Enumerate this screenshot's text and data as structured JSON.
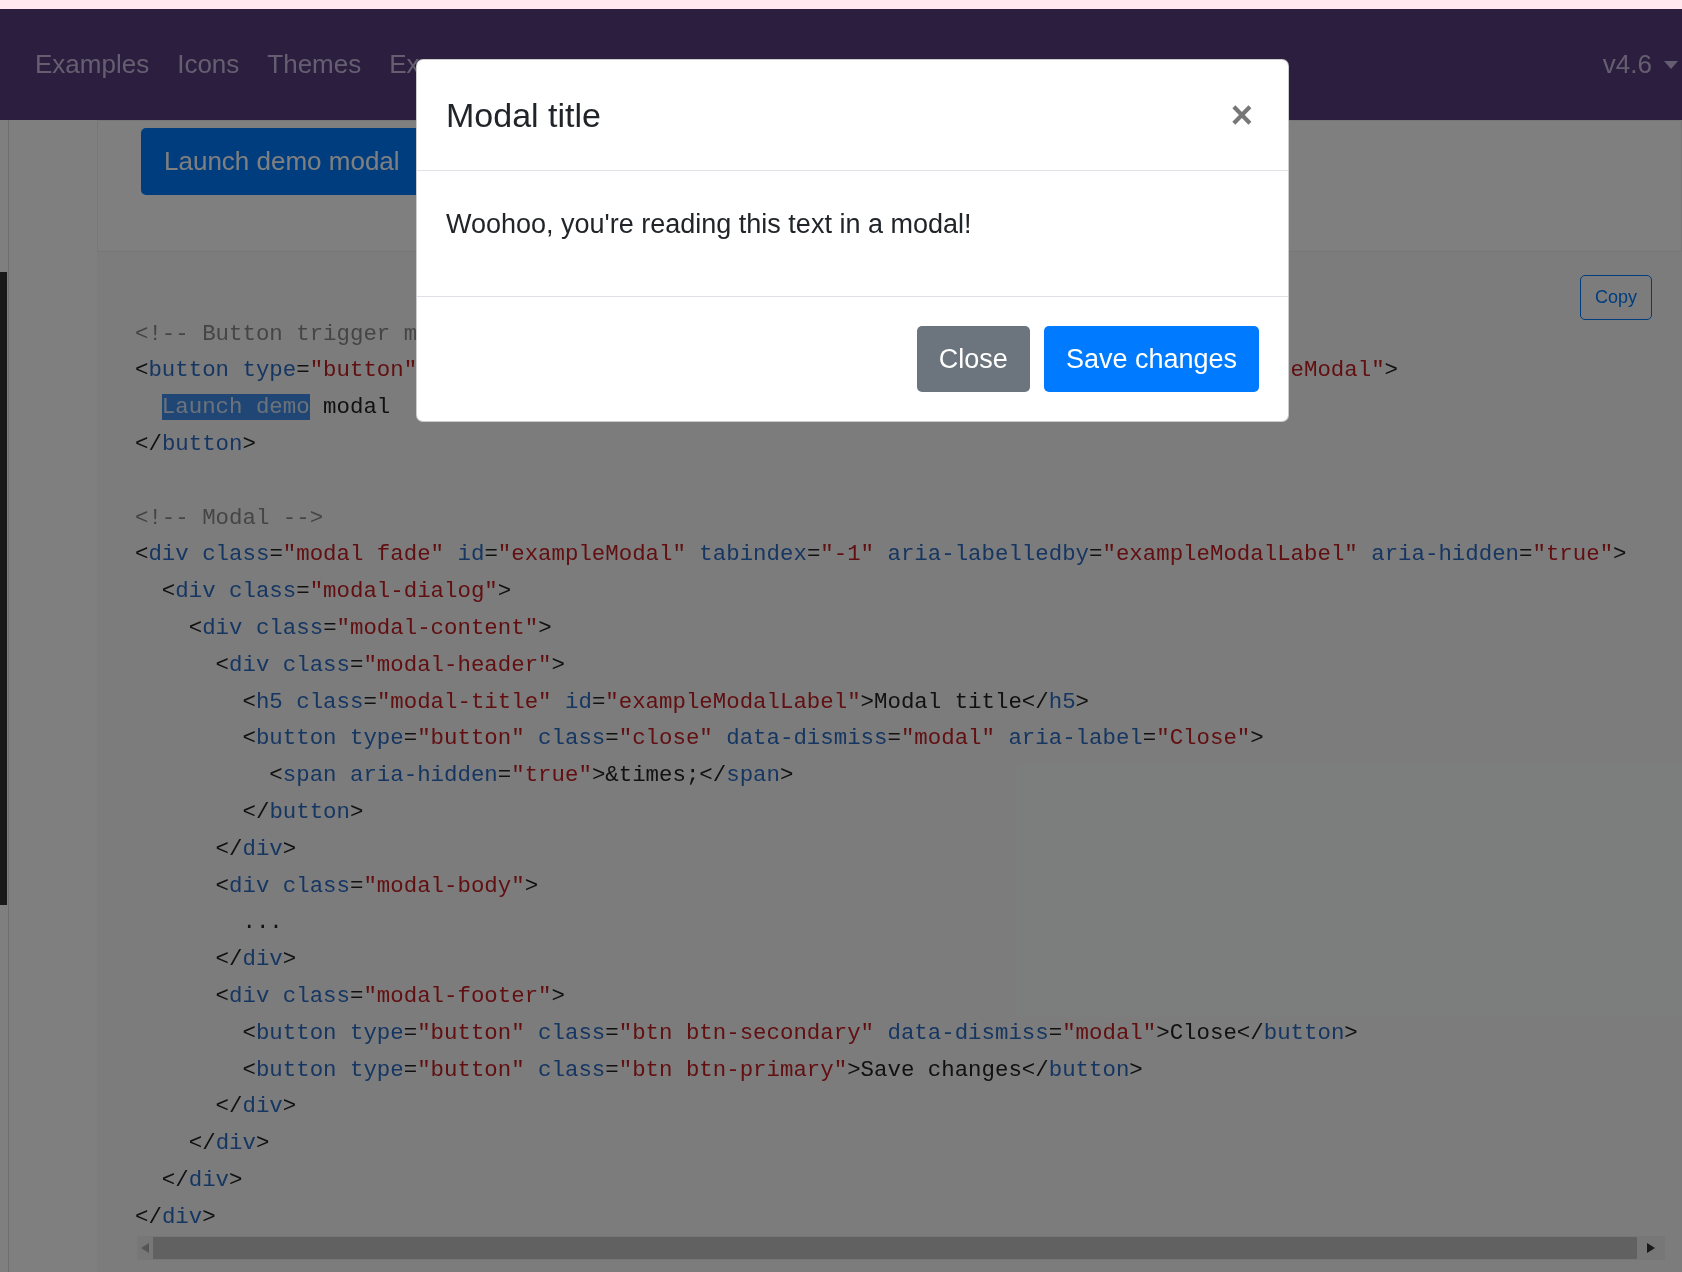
{
  "nav": {
    "items": [
      {
        "label": "Examples"
      },
      {
        "label": "Icons"
      },
      {
        "label": "Themes"
      },
      {
        "label": "Ex"
      }
    ],
    "version": "v4.6"
  },
  "example": {
    "button": "Launch demo modal"
  },
  "code": {
    "copy_button": "Copy",
    "blocks": [
      [
        {
          "left": [
            {
              "kind": "comment",
              "text": "<!-- Button trigger m"
            }
          ]
        },
        {
          "left": [
            {
              "kind": "plain",
              "text": "<"
            },
            {
              "kind": "tag",
              "text": "button"
            },
            {
              "kind": "attr",
              "text": " type"
            },
            {
              "kind": "plain",
              "text": "="
            },
            {
              "kind": "value",
              "text": "\"button\""
            }
          ],
          "right": [
            {
              "kind": "value",
              "text": "eModal\""
            },
            {
              "kind": "plain",
              "text": ">"
            }
          ]
        },
        {
          "kind": "nested",
          "left": [
            {
              "kind": "selected",
              "text": "Launch demo"
            },
            {
              "kind": "plain",
              "text": " modal"
            }
          ]
        },
        {
          "left": [
            {
              "kind": "plain",
              "text": "</"
            },
            {
              "kind": "tag",
              "text": "button"
            },
            {
              "kind": "plain",
              "text": ">"
            }
          ]
        }
      ],
      [
        {
          "left": [
            {
              "kind": "comment",
              "text": "<!-- Modal -->"
            }
          ]
        },
        {
          "left": [
            {
              "kind": "plain",
              "text": "<"
            },
            {
              "kind": "tag",
              "text": "div"
            },
            {
              "kind": "attr",
              "text": " class"
            },
            {
              "kind": "plain",
              "text": "="
            },
            {
              "kind": "value",
              "text": "\"modal fade\""
            },
            {
              "kind": "attr",
              "text": " id"
            },
            {
              "kind": "plain",
              "text": "="
            },
            {
              "kind": "value",
              "text": "\"exampleModal\""
            },
            {
              "kind": "attr",
              "text": " tabindex"
            },
            {
              "kind": "plain",
              "text": "="
            },
            {
              "kind": "value",
              "text": "\"-1\""
            },
            {
              "kind": "attr",
              "text": " aria-labelledby"
            },
            {
              "kind": "plain",
              "text": "="
            },
            {
              "kind": "value",
              "text": "\"exampleModalLabel\""
            },
            {
              "kind": "attr",
              "text": " aria-hidden"
            },
            {
              "kind": "plain",
              "text": "="
            },
            {
              "kind": "value",
              "text": "\"true\""
            },
            {
              "kind": "plain",
              "text": ">"
            }
          ]
        },
        {
          "left": [
            {
              "kind": "plain",
              "text": "  <"
            },
            {
              "kind": "tag",
              "text": "div"
            },
            {
              "kind": "attr",
              "text": " class"
            },
            {
              "kind": "plain",
              "text": "="
            },
            {
              "kind": "value",
              "text": "\"modal-dialog\""
            },
            {
              "kind": "plain",
              "text": ">"
            }
          ]
        },
        {
          "left": [
            {
              "kind": "plain",
              "text": "    <"
            },
            {
              "kind": "tag",
              "text": "div"
            },
            {
              "kind": "attr",
              "text": " class"
            },
            {
              "kind": "plain",
              "text": "="
            },
            {
              "kind": "value",
              "text": "\"modal-content\""
            },
            {
              "kind": "plain",
              "text": ">"
            }
          ]
        },
        {
          "left": [
            {
              "kind": "plain",
              "text": "      <"
            },
            {
              "kind": "tag",
              "text": "div"
            },
            {
              "kind": "attr",
              "text": " class"
            },
            {
              "kind": "plain",
              "text": "="
            },
            {
              "kind": "value",
              "text": "\"modal-header\""
            },
            {
              "kind": "plain",
              "text": ">"
            }
          ]
        },
        {
          "left": [
            {
              "kind": "plain",
              "text": "        <"
            },
            {
              "kind": "tag",
              "text": "h5"
            },
            {
              "kind": "attr",
              "text": " class"
            },
            {
              "kind": "plain",
              "text": "="
            },
            {
              "kind": "value",
              "text": "\"modal-title\""
            },
            {
              "kind": "attr",
              "text": " id"
            },
            {
              "kind": "plain",
              "text": "="
            },
            {
              "kind": "value",
              "text": "\"exampleModalLabel\""
            },
            {
              "kind": "plain",
              "text": ">Modal title</"
            },
            {
              "kind": "tag",
              "text": "h5"
            },
            {
              "kind": "plain",
              "text": ">"
            }
          ]
        },
        {
          "left": [
            {
              "kind": "plain",
              "text": "        <"
            },
            {
              "kind": "tag",
              "text": "button"
            },
            {
              "kind": "attr",
              "text": " type"
            },
            {
              "kind": "plain",
              "text": "="
            },
            {
              "kind": "value",
              "text": "\"button\""
            },
            {
              "kind": "attr",
              "text": " class"
            },
            {
              "kind": "plain",
              "text": "="
            },
            {
              "kind": "value",
              "text": "\"close\""
            },
            {
              "kind": "attr",
              "text": " data-dismiss"
            },
            {
              "kind": "plain",
              "text": "="
            },
            {
              "kind": "value",
              "text": "\"modal\""
            },
            {
              "kind": "attr",
              "text": " aria-label"
            },
            {
              "kind": "plain",
              "text": "="
            },
            {
              "kind": "value",
              "text": "\"Close\""
            },
            {
              "kind": "plain",
              "text": ">"
            }
          ]
        },
        {
          "left": [
            {
              "kind": "plain",
              "text": "          <"
            },
            {
              "kind": "tag",
              "text": "span"
            },
            {
              "kind": "attr",
              "text": " aria-hidden"
            },
            {
              "kind": "plain",
              "text": "="
            },
            {
              "kind": "value",
              "text": "\"true\""
            },
            {
              "kind": "plain",
              "text": ">&times;</"
            },
            {
              "kind": "tag",
              "text": "span"
            },
            {
              "kind": "plain",
              "text": ">"
            }
          ]
        },
        {
          "left": [
            {
              "kind": "plain",
              "text": "        </"
            },
            {
              "kind": "tag",
              "text": "button"
            },
            {
              "kind": "plain",
              "text": ">"
            }
          ]
        },
        {
          "left": [
            {
              "kind": "plain",
              "text": "      </"
            },
            {
              "kind": "tag",
              "text": "div"
            },
            {
              "kind": "plain",
              "text": ">"
            }
          ]
        },
        {
          "left": [
            {
              "kind": "plain",
              "text": "      <"
            },
            {
              "kind": "tag",
              "text": "div"
            },
            {
              "kind": "attr",
              "text": " class"
            },
            {
              "kind": "plain",
              "text": "="
            },
            {
              "kind": "value",
              "text": "\"modal-body\""
            },
            {
              "kind": "plain",
              "text": ">"
            }
          ]
        },
        {
          "left": [
            {
              "kind": "plain",
              "text": "        ..."
            }
          ]
        },
        {
          "left": [
            {
              "kind": "plain",
              "text": "      </"
            },
            {
              "kind": "tag",
              "text": "div"
            },
            {
              "kind": "plain",
              "text": ">"
            }
          ]
        },
        {
          "left": [
            {
              "kind": "plain",
              "text": "      <"
            },
            {
              "kind": "tag",
              "text": "div"
            },
            {
              "kind": "attr",
              "text": " class"
            },
            {
              "kind": "plain",
              "text": "="
            },
            {
              "kind": "value",
              "text": "\"modal-footer\""
            },
            {
              "kind": "plain",
              "text": ">"
            }
          ]
        },
        {
          "left": [
            {
              "kind": "plain",
              "text": "        <"
            },
            {
              "kind": "tag",
              "text": "button"
            },
            {
              "kind": "attr",
              "text": " type"
            },
            {
              "kind": "plain",
              "text": "="
            },
            {
              "kind": "value",
              "text": "\"button\""
            },
            {
              "kind": "attr",
              "text": " class"
            },
            {
              "kind": "plain",
              "text": "="
            },
            {
              "kind": "value",
              "text": "\"btn btn-secondary\""
            },
            {
              "kind": "attr",
              "text": " data-dismiss"
            },
            {
              "kind": "plain",
              "text": "="
            },
            {
              "kind": "value",
              "text": "\"modal\""
            },
            {
              "kind": "plain",
              "text": ">Close</"
            },
            {
              "kind": "tag",
              "text": "button"
            },
            {
              "kind": "plain",
              "text": ">"
            }
          ]
        },
        {
          "left": [
            {
              "kind": "plain",
              "text": "        <"
            },
            {
              "kind": "tag",
              "text": "button"
            },
            {
              "kind": "attr",
              "text": " type"
            },
            {
              "kind": "plain",
              "text": "="
            },
            {
              "kind": "value",
              "text": "\"button\""
            },
            {
              "kind": "attr",
              "text": " class"
            },
            {
              "kind": "plain",
              "text": "="
            },
            {
              "kind": "value",
              "text": "\"btn btn-primary\""
            },
            {
              "kind": "plain",
              "text": ">Save changes</"
            },
            {
              "kind": "tag",
              "text": "button"
            },
            {
              "kind": "plain",
              "text": ">"
            }
          ]
        },
        {
          "left": [
            {
              "kind": "plain",
              "text": "      </"
            },
            {
              "kind": "tag",
              "text": "div"
            },
            {
              "kind": "plain",
              "text": ">"
            }
          ]
        },
        {
          "left": [
            {
              "kind": "plain",
              "text": "    </"
            },
            {
              "kind": "tag",
              "text": "div"
            },
            {
              "kind": "plain",
              "text": ">"
            }
          ]
        },
        {
          "left": [
            {
              "kind": "plain",
              "text": "  </"
            },
            {
              "kind": "tag",
              "text": "div"
            },
            {
              "kind": "plain",
              "text": ">"
            }
          ]
        },
        {
          "left": [
            {
              "kind": "plain",
              "text": "</"
            },
            {
              "kind": "tag",
              "text": "div"
            },
            {
              "kind": "plain",
              "text": ">"
            }
          ]
        }
      ]
    ]
  },
  "modal": {
    "title": "Modal title",
    "close_icon": "×",
    "body": "Woohoo, you're reading this text in a modal!",
    "buttons": [
      {
        "label": "Close",
        "kind": "secondary"
      },
      {
        "label": "Save changes",
        "kind": "primary"
      }
    ]
  }
}
